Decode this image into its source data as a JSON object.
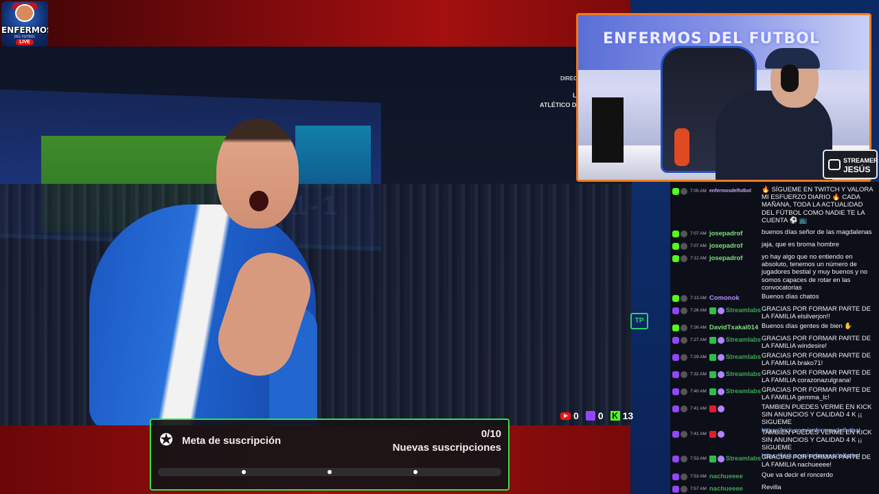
{
  "logo": {
    "word": "ENFERMOS",
    "sub": "DEL FUTBOL",
    "live": "LIVE"
  },
  "broadcast": {
    "live_label": "DIREC",
    "score_text": "1-1",
    "team_line_1": "L",
    "team_line_2": "ATLÉTICO DE I",
    "tp_badge": "TP",
    "viewers": {
      "youtube": "0",
      "twitch": "0",
      "kick": "13"
    }
  },
  "goal": {
    "title": "Meta de suscripción",
    "count": "0/10",
    "label": "Nuevas suscripciones",
    "progress": 0,
    "milestones": [
      0.25,
      0.5,
      0.75
    ]
  },
  "webcam": {
    "banner": "ENFERMOS DEL FUTBOL",
    "tag_line_1": "STREAMER",
    "tag_line_2": "JESÚS"
  },
  "colors": {
    "kick": "#53fc18",
    "twitch": "#9146ff",
    "youtube": "#ff1010",
    "goal_border": "#33e34a",
    "cam_border": "#f07a1c"
  },
  "chat": [
    {
      "platform": "kick",
      "time": "7:05 AM",
      "user": "enfermosdelfutbol",
      "user_color": "#c7a6ff",
      "text": "🔥 SÍGUEME EN TWITCH Y VALORA MI ESFUERZO DIARIO 🔥 CADA MAÑANA, TODA LA ACTUALIDAD DEL FÚTBOL COMO NADIE TE LA CUENTA ⚽ 📺"
    },
    {
      "platform": "kick",
      "time": "7:07 AM",
      "user": "josepadrof",
      "user_color": "#7ee07e",
      "text": "buenos días señor de las magdalenas"
    },
    {
      "platform": "kick",
      "time": "7:07 AM",
      "user": "josepadrof",
      "user_color": "#7ee07e",
      "text": "jaja, que es broma hombre"
    },
    {
      "platform": "kick",
      "time": "7:12 AM",
      "user": "josepadrof",
      "user_color": "#7ee07e",
      "text": "yo hay algo que no entiendo en absoluto, tenemos un número de jugadores bestial y muy buenos y no somos capaces de rotar en las convocatorias"
    },
    {
      "platform": "kick",
      "time": "7:13 AM",
      "user": "Comonok",
      "user_color": "#b48cff",
      "text": "Buenos días chatos"
    },
    {
      "platform": "twitch",
      "time": "7:26 AM",
      "user": "Streamlabs",
      "user_color": "#3aa655",
      "text": "GRACIAS POR FORMAR PARTE DE LA FAMILIA elsilverjon!!"
    },
    {
      "platform": "kick",
      "time": "7:26 AM",
      "user": "DavidTxakal014",
      "user_color": "#7ee07e",
      "text": "Buenos días gentes de bien ✋"
    },
    {
      "platform": "twitch",
      "time": "7:27 AM",
      "user": "Streamlabs",
      "user_color": "#3aa655",
      "text": "GRACIAS POR FORMAR PARTE DE LA FAMILIA windesire!"
    },
    {
      "platform": "twitch",
      "time": "7:29 AM",
      "user": "Streamlabs",
      "user_color": "#3aa655",
      "text": "GRACIAS POR FORMAR PARTE DE LA FAMILIA brako71!"
    },
    {
      "platform": "twitch",
      "time": "7:32 AM",
      "user": "Streamlabs",
      "user_color": "#3aa655",
      "text": "GRACIAS POR FORMAR PARTE DE LA FAMILIA corazonazulgrana!"
    },
    {
      "platform": "twitch",
      "time": "7:40 AM",
      "user": "Streamlabs",
      "user_color": "#3aa655",
      "text": "GRACIAS POR FORMAR PARTE DE LA FAMILIA gemma_lc!"
    },
    {
      "platform": "twitch",
      "time": "7:41 AM",
      "user": "",
      "user_color": "#e01e2a",
      "text": "TAMBIEN PUEDES VERME EN KICK SIN ANUNCIOS Y CALIDAD 4 K ¡¡ SIGUEME",
      "link": "https://kick.com/enfermosdelfutbol"
    },
    {
      "platform": "twitch",
      "time": "7:41 AM",
      "user": "",
      "user_color": "#e01e2a",
      "text": "TAMBIEN PUEDES VERME EN KICK SIN ANUNCIOS Y CALIDAD 4 K ¡¡ SIGUEME",
      "link": "https://kick.com/enfermosdelfutbol"
    },
    {
      "platform": "twitch",
      "time": "7:53 AM",
      "user": "Streamlabs",
      "user_color": "#3aa655",
      "text": "GRACIAS POR FORMAR PARTE DE LA FAMILIA nachueeee!"
    },
    {
      "platform": "twitch",
      "time": "7:53 AM",
      "user": "nachueeee",
      "user_color": "#3aa655",
      "text": "Que va decir el roncerdo"
    },
    {
      "platform": "twitch",
      "time": "7:57 AM",
      "user": "nachueeee",
      "user_color": "#3aa655",
      "text": "Revilla"
    }
  ]
}
